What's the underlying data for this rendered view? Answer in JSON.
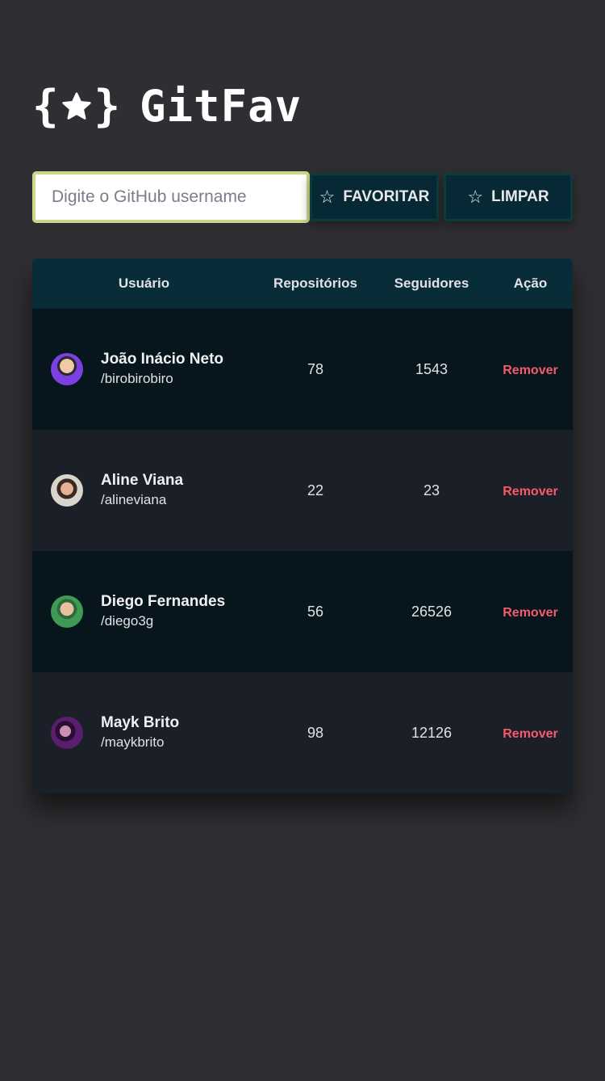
{
  "app": {
    "brand_open": "{",
    "brand_close": "}",
    "title": "GitFav"
  },
  "search": {
    "placeholder": "Digite o GitHub username",
    "value": ""
  },
  "buttons": {
    "favorite_label": "FAVORITAR",
    "clear_label": "LIMPAR",
    "star_glyph": "☆"
  },
  "table": {
    "headers": {
      "user": "Usuário",
      "repos": "Repositórios",
      "followers": "Seguidores",
      "action": "Ação"
    },
    "rows": [
      {
        "name": "João Inácio Neto",
        "login": "/birobirobiro",
        "repos": "78",
        "followers": "1543",
        "action": "Remover",
        "avatar_color": "#7b3fe4"
      },
      {
        "name": "Aline Viana",
        "login": "/alineviana",
        "repos": "22",
        "followers": "23",
        "action": "Remover",
        "avatar_color": "#c9a98a"
      },
      {
        "name": "Diego Fernandes",
        "login": "/diego3g",
        "repos": "56",
        "followers": "26526",
        "action": "Remover",
        "avatar_color": "#3e9a55"
      },
      {
        "name": "Mayk Brito",
        "login": "/maykbrito",
        "repos": "98",
        "followers": "12126",
        "action": "Remover",
        "avatar_color": "#5a1e6e"
      }
    ]
  },
  "colors": {
    "background": "#2f2e32",
    "accent_border": "#cfd68b",
    "button_bg": "#062935",
    "header_bg": "#092d38",
    "row_dark": "#06161c",
    "row_alt": "#1b1f27",
    "remove": "#f75a68"
  }
}
